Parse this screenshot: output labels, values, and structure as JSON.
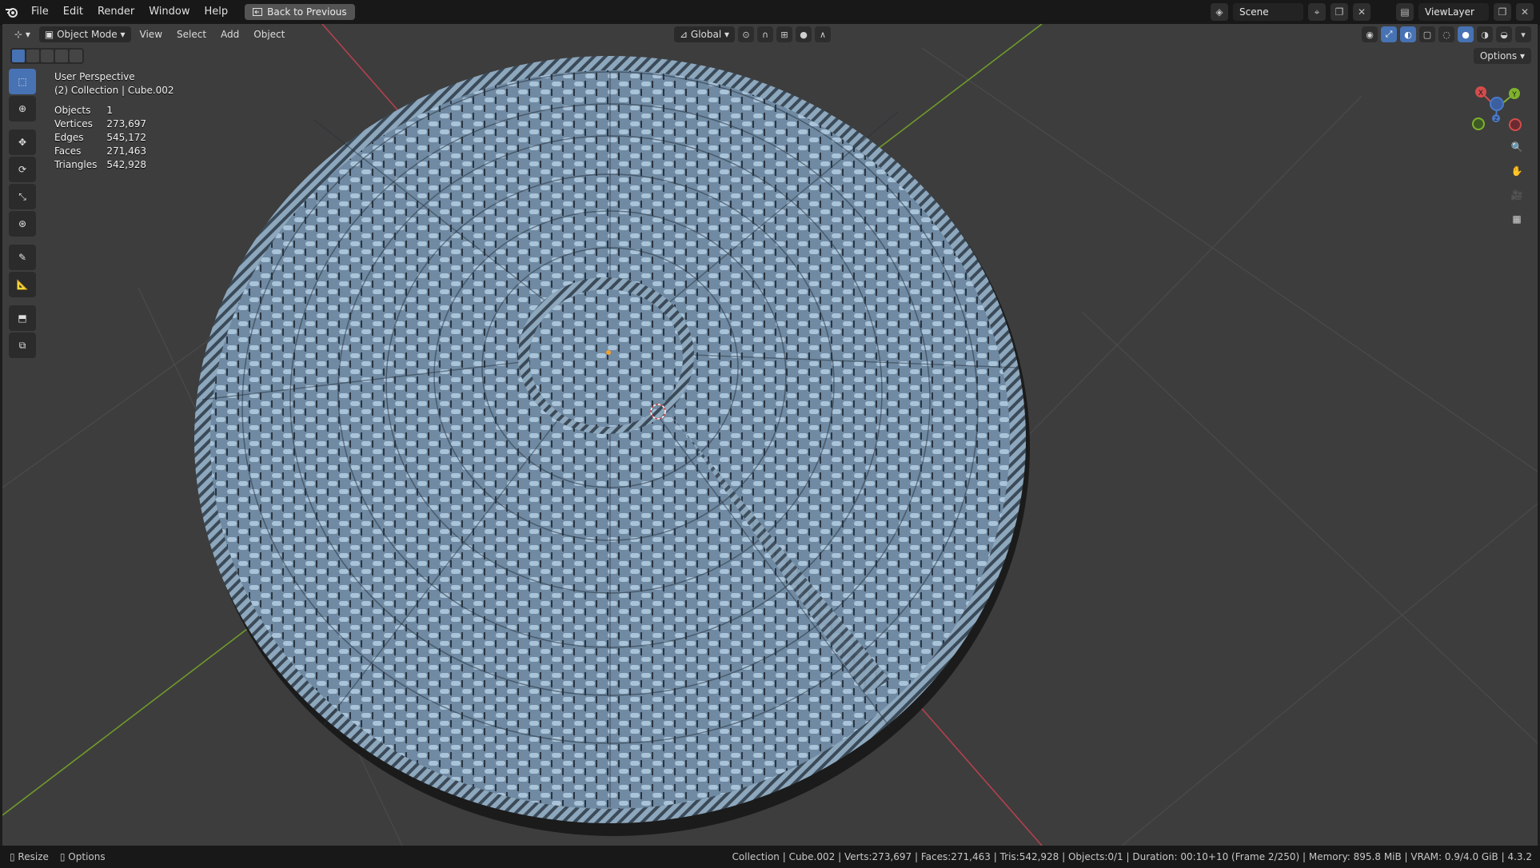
{
  "menu": {
    "file": "File",
    "edit": "Edit",
    "render": "Render",
    "window": "Window",
    "help": "Help",
    "back_to_previous": "Back to Previous"
  },
  "topbar_right": {
    "scene": "Scene",
    "view_layer": "ViewLayer"
  },
  "viewport_header": {
    "mode": "Object Mode",
    "view": "View",
    "select": "Select",
    "add": "Add",
    "object": "Object",
    "orientation": "Global",
    "options": "Options"
  },
  "overlay": {
    "perspective": "User Perspective",
    "collection": "(2) Collection | Cube.002",
    "stats": [
      {
        "label": "Objects",
        "value": "1"
      },
      {
        "label": "Vertices",
        "value": "273,697"
      },
      {
        "label": "Edges",
        "value": "545,172"
      },
      {
        "label": "Faces",
        "value": "271,463"
      },
      {
        "label": "Triangles",
        "value": "542,928"
      }
    ]
  },
  "gizmo": {
    "x": "X",
    "y": "Y",
    "z": "Z"
  },
  "statusbar": {
    "resize": "Resize",
    "options": "Options",
    "info": "Collection | Cube.002 | Verts:273,697 | Faces:271,463 | Tris:542,928 | Objects:0/1 | Duration: 00:10+10 (Frame 2/250) | Memory: 895.8 MiB | VRAM: 0.9/4.0 GiB | 4.3.2"
  },
  "colors": {
    "viewport_bg": "#3d3d3d",
    "basket": "#8aa6bf",
    "x_axis": "#b5404f",
    "y_axis": "#6f9a2b",
    "accent": "#4772b3"
  }
}
